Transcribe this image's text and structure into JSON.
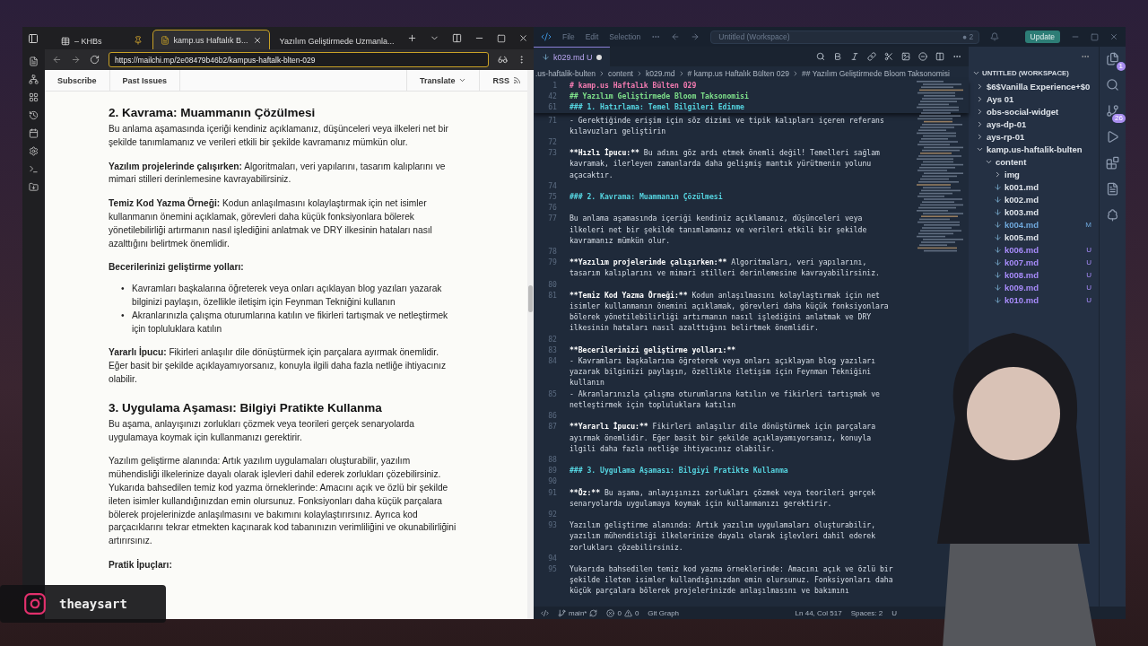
{
  "browser": {
    "tabs": [
      {
        "label": "– KHBs",
        "selected": false,
        "kind": "table"
      },
      {
        "label": "kamp.us Haftalık B...",
        "selected": true,
        "kind": "page"
      },
      {
        "label": "Yazılım Geliştirmede Uzmanla...",
        "selected": false,
        "kind": "plain"
      }
    ],
    "address": "https://mailchi.mp/2e08479b46b2/kampus-haftalk-blten-029",
    "nav": {
      "left": [
        "Subscribe",
        "Past Issues"
      ],
      "translate": "Translate",
      "rss": "RSS"
    },
    "article": [
      {
        "kind": "h2",
        "text": "2. Kavrama: Muammanın Çözülmesi"
      },
      {
        "kind": "p",
        "text": "Bu anlama aşamasında içeriği kendiniz açıklamanız, düşünceleri veya ilkeleri net bir şekilde tanımlamanız ve verileri etkili bir şekilde kavramanız mümkün olur."
      },
      {
        "kind": "p",
        "text": "**Yazılım projelerinde çalışırken:** Algoritmaları, veri yapılarını, tasarım kalıplarını ve mimari stilleri derinlemesine kavrayabilirsiniz."
      },
      {
        "kind": "p",
        "text": "**Temiz Kod Yazma Örneği:** Kodun anlaşılmasını kolaylaştırmak için net isimler kullanmanın önemini açıklamak, görevleri daha küçük fonksiyonlara bölerek yönetilebilirliği artırmanın nasıl işlediğini anlatmak ve DRY ilkesinin hataları nasıl azalttığını belirtmek önemlidir."
      },
      {
        "kind": "strong",
        "text": "Becerilerinizi geliştirme yolları:"
      },
      {
        "kind": "ul",
        "marker": "•",
        "items": [
          "Kavramları başkalarına öğreterek veya onları açıklayan blog yazıları yazarak bilginizi paylaşın, özellikle iletişim için Feynman Tekniğini kullanın",
          "Akranlarınızla çalışma oturumlarına katılın ve fikirleri tartışmak ve netleştirmek için topluluklara katılın"
        ]
      },
      {
        "kind": "p",
        "text": "**Yararlı İpucu:** Fikirleri anlaşılır dile dönüştürmek için parçalara ayırmak önemlidir. Eğer basit bir şekilde açıklayamıyorsanız, konuyla ilgili daha fazla netliğe ihtiyacınız olabilir."
      },
      {
        "kind": "h2",
        "text": "3. Uygulama Aşaması: Bilgiyi Pratikte Kullanma"
      },
      {
        "kind": "p",
        "text": "Bu aşama, anlayışınızı zorlukları çözmek veya teorileri gerçek senaryolarda uygulamaya koymak için kullanmanızı gerektirir."
      },
      {
        "kind": "p",
        "text": "Yazılım geliştirme alanında: Artık yazılım uygulamaları oluşturabilir, yazılım mühendisliği ilkelerinize dayalı olarak işlevleri dahil ederek zorlukları çözebilirsiniz. Yukarıda bahsedilen temiz kod yazma örneklerinde: Amacını açık ve özlü bir şekilde ileten isimler kullandığınızdan emin olursunuz. Fonksiyonları daha küçük parçalara bölerek projelerinizde anlaşılmasını ve bakımını kolaylaştırırsınız. Ayrıca kod parçacıklarını tekrar etmekten kaçınarak kod tabanınızın verimliliğini ve okunabilirliğini artırırsınız."
      },
      {
        "kind": "strong",
        "text": "Pratik İpuçları:"
      }
    ]
  },
  "editor": {
    "menu": [
      "File",
      "Edit",
      "Selection"
    ],
    "workspace": "Untitled (Workspace)",
    "notifications": "● 2",
    "update": "Update",
    "tab": {
      "label": "k029.md",
      "status": "U",
      "modified": true
    },
    "breadcrumb": [
      ".us-haftalik-bulten",
      "content",
      "k029.md",
      "# kamp.us Haftalık Bülten 029",
      "## Yazılım Geliştirmede Bloom Taksonomisi"
    ],
    "sticky": [
      {
        "n": "1",
        "kind": "h1",
        "text": "# kamp.us Haftalık Bülten 029"
      },
      {
        "n": "42",
        "kind": "h2",
        "text": "## Yazılım Geliştirmede Bloom Taksonomisi"
      },
      {
        "n": "61",
        "kind": "h3",
        "text": "### 1. Hatırlama: Temel Bilgileri Edinme"
      }
    ],
    "lines": [
      {
        "n": "71",
        "kind": "list",
        "text": "- Gerektiğinde erişim için söz dizimi ve tipik kalıpları içeren referans kılavuzları geliştirin"
      },
      {
        "n": "72",
        "kind": "blank"
      },
      {
        "n": "73",
        "kind": "lead",
        "lead": "**Hızlı İpucu:**",
        "text": " Bu adımı göz ardı etmek önemli değil! Temelleri sağlam kavramak, ilerleyen zamanlarda daha gelişmiş mantık yürütmenin yolunu açacaktır."
      },
      {
        "n": "74",
        "kind": "blank"
      },
      {
        "n": "75",
        "kind": "h3",
        "text": "### 2. Kavrama: Muammanın Çözülmesi"
      },
      {
        "n": "76",
        "kind": "blank"
      },
      {
        "n": "77",
        "kind": "plain",
        "text": "Bu anlama aşamasında içeriği kendiniz açıklamanız, düşünceleri veya ilkeleri net bir şekilde tanımlamanız ve verileri etkili bir şekilde kavramanız mümkün olur."
      },
      {
        "n": "78",
        "kind": "blank"
      },
      {
        "n": "79",
        "kind": "lead",
        "lead": "**Yazılım projelerinde çalışırken:**",
        "text": " Algoritmaları, veri yapılarını, tasarım kalıplarını ve mimari stilleri derinlemesine kavrayabilirsiniz."
      },
      {
        "n": "80",
        "kind": "blank"
      },
      {
        "n": "81",
        "kind": "lead",
        "lead": "**Temiz Kod Yazma Örneği:**",
        "text": " Kodun anlaşılmasını kolaylaştırmak için net isimler kullanmanın önemini açıklamak, görevleri daha küçük fonksiyonlara bölerek yönetilebilirliği artırmanın nasıl işlediğini anlatmak ve DRY ilkesinin hataları nasıl azalttığını belirtmek önemlidir."
      },
      {
        "n": "82",
        "kind": "blank"
      },
      {
        "n": "83",
        "kind": "lead",
        "lead": "**Becerilerinizi geliştirme yolları:**"
      },
      {
        "n": "84",
        "kind": "list",
        "text": "- Kavramları başkalarına öğreterek veya onları açıklayan blog yazıları yazarak bilginizi paylaşın, özellikle iletişim için Feynman Tekniğini kullanın"
      },
      {
        "n": "85",
        "kind": "list",
        "text": "- Akranlarınızla çalışma oturumlarına katılın ve fikirleri tartışmak ve netleştirmek için topluluklara katılın"
      },
      {
        "n": "86",
        "kind": "blank"
      },
      {
        "n": "87",
        "kind": "lead",
        "lead": "**Yararlı İpucu:**",
        "text": " Fikirleri anlaşılır dile dönüştürmek için parçalara ayırmak önemlidir. Eğer basit bir şekilde açıklayamıyorsanız, konuyla ilgili daha fazla netliğe ihtiyacınız olabilir."
      },
      {
        "n": "88",
        "kind": "blank"
      },
      {
        "n": "89",
        "kind": "h3",
        "text": "### 3. Uygulama Aşaması: Bilgiyi Pratikte Kullanma"
      },
      {
        "n": "90",
        "kind": "blank"
      },
      {
        "n": "91",
        "kind": "lead",
        "lead": "**Öz:**",
        "text": " Bu aşama, anlayışınızı zorlukları çözmek veya teorileri gerçek senaryolarda uygulamaya koymak için kullanmanızı gerektirir."
      },
      {
        "n": "92",
        "kind": "blank"
      },
      {
        "n": "93",
        "kind": "plain",
        "text": "Yazılım geliştirme alanında: Artık yazılım uygulamaları oluşturabilir, yazılım mühendisliği ilkelerinize dayalı olarak işlevleri dahil ederek zorlukları çözebilirsiniz."
      },
      {
        "n": "94",
        "kind": "blank"
      },
      {
        "n": "95",
        "kind": "plain",
        "text": "Yukarıda bahsedilen temiz kod yazma örneklerinde: Amacını açık ve özlü bir şekilde ileten isimler kullandığınızdan emin olursunuz. Fonksiyonları daha küçük parçalara bölerek projelerinizde anlaşılmasını ve bakımını"
      }
    ],
    "explorer": {
      "title": "UNTITLED (WORKSPACE)",
      "tree": [
        {
          "kind": "folder",
          "label": "$6$Vanilla Experience+$0",
          "expanded": false
        },
        {
          "kind": "folder",
          "label": "Ays 01",
          "expanded": false
        },
        {
          "kind": "folder",
          "label": "obs-social-widget",
          "expanded": false
        },
        {
          "kind": "folder",
          "label": "ays-dp-01",
          "expanded": false
        },
        {
          "kind": "folder",
          "label": "ays-rp-01",
          "expanded": false
        },
        {
          "kind": "folder",
          "label": "kamp.us-haftalik-bulten",
          "expanded": true,
          "children": [
            {
              "kind": "folder",
              "label": "content",
              "expanded": true,
              "children": [
                {
                  "kind": "folder",
                  "label": "img",
                  "expanded": false
                },
                {
                  "kind": "file",
                  "label": "k001.md"
                },
                {
                  "kind": "file",
                  "label": "k002.md"
                },
                {
                  "kind": "file",
                  "label": "k003.md"
                },
                {
                  "kind": "file",
                  "label": "k004.md",
                  "status": "M",
                  "color": "#6fa8dc"
                },
                {
                  "kind": "file",
                  "label": "k005.md"
                },
                {
                  "kind": "file",
                  "label": "k006.md",
                  "status": "U",
                  "color": "#a78bfa"
                },
                {
                  "kind": "file",
                  "label": "k007.md",
                  "status": "U",
                  "color": "#a78bfa"
                },
                {
                  "kind": "file",
                  "label": "k008.md",
                  "status": "U",
                  "color": "#a78bfa"
                },
                {
                  "kind": "file",
                  "label": "k009.md",
                  "status": "U",
                  "color": "#a78bfa"
                },
                {
                  "kind": "file",
                  "label": "k010.md",
                  "status": "U",
                  "color": "#a78bfa"
                }
              ]
            }
          ]
        }
      ]
    },
    "badges": {
      "explorer": "1",
      "scm": "26"
    },
    "status": {
      "branch": "main*",
      "errors": "0",
      "warnings": "0",
      "git": "Git Graph",
      "position": "Ln 44, Col 517",
      "spaces": "Spaces: 2",
      "extra": "U"
    }
  },
  "social": {
    "handle": "theaysart"
  }
}
